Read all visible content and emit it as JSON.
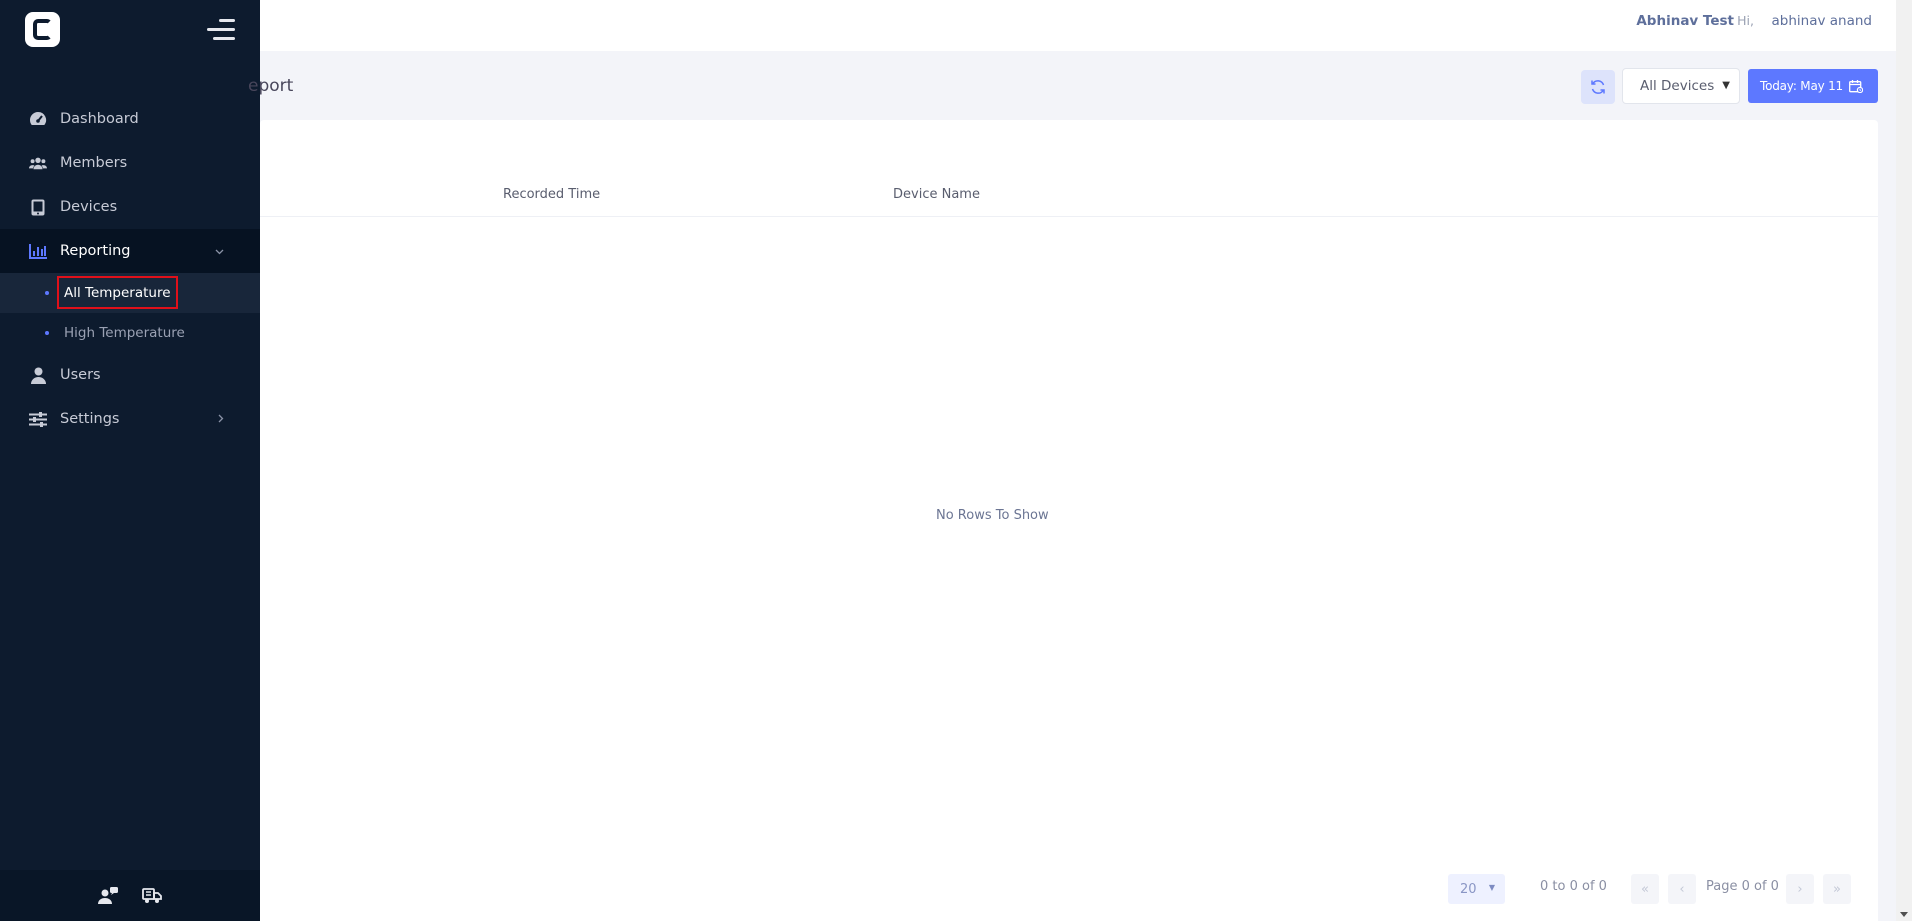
{
  "sidebar": {
    "items": [
      {
        "label": "Dashboard",
        "icon": "dashboard-gauge-icon"
      },
      {
        "label": "Members",
        "icon": "users-group-icon"
      },
      {
        "label": "Devices",
        "icon": "tablet-icon"
      },
      {
        "label": "Reporting",
        "icon": "bar-chart-icon",
        "active": true,
        "expanded": true
      },
      {
        "label": "Users",
        "icon": "user-icon"
      },
      {
        "label": "Settings",
        "icon": "sliders-icon"
      }
    ],
    "reporting_sub": [
      {
        "label": "All Temperature",
        "current": true
      },
      {
        "label": "High Temperature"
      }
    ]
  },
  "header": {
    "org": "Abhinav Test",
    "greeting": "Hi,",
    "user": "abhinav anand"
  },
  "subheader": {
    "title": "eport",
    "device_filter": "All Devices",
    "date_label": "Today: May 11"
  },
  "grid": {
    "columns": [
      "Recorded Time",
      "Device Name"
    ],
    "empty_text": "No Rows To Show"
  },
  "pager": {
    "page_size": "20",
    "range": "0 to 0 of 0",
    "page": "Page 0 of 0",
    "first": "«",
    "prev": "‹",
    "next": "›",
    "last": "»"
  },
  "colors": {
    "sidebar_bg": "#0d1b2e",
    "accent": "#5d78ff",
    "highlight": "#e0101a"
  }
}
